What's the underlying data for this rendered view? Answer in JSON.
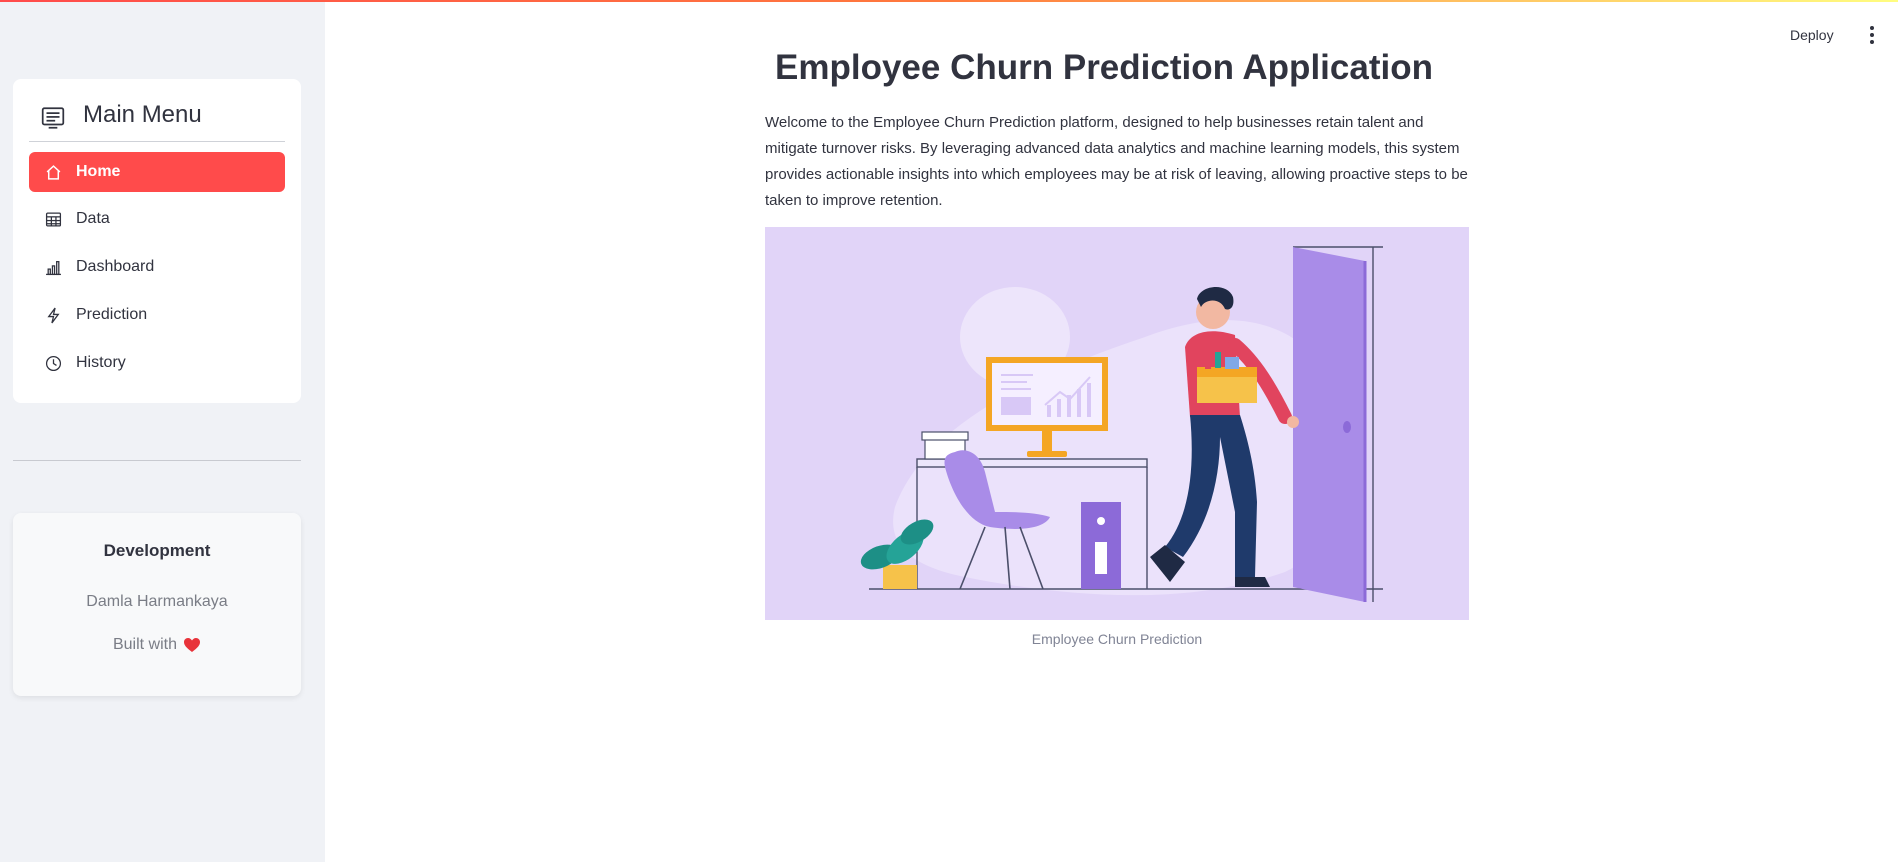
{
  "sidebar": {
    "menu_title": "Main Menu",
    "items": [
      {
        "label": "Home",
        "icon": "house-icon",
        "active": true
      },
      {
        "label": "Data",
        "icon": "table-icon",
        "active": false
      },
      {
        "label": "Dashboard",
        "icon": "bar-chart-icon",
        "active": false
      },
      {
        "label": "Prediction",
        "icon": "lightning-icon",
        "active": false
      },
      {
        "label": "History",
        "icon": "clock-icon",
        "active": false
      }
    ],
    "development": {
      "title": "Development",
      "author": "Damla Harmankaya",
      "built_with": "Built with"
    }
  },
  "header": {
    "deploy_label": "Deploy"
  },
  "main": {
    "title": "Employee Churn Prediction Application",
    "intro": "Welcome to the Employee Churn Prediction platform, designed to help businesses retain talent and mitigate turnover risks. By leveraging advanced data analytics and machine learning models, this system provides actionable insights into which employees may be at risk of leaving, allowing proactive steps to be taken to improve retention.",
    "image_caption": "Employee Churn Prediction"
  },
  "colors": {
    "accent": "#ff4b4b",
    "sidebar_bg": "#f0f2f6",
    "illustration_bg": "#e1d4f8"
  }
}
